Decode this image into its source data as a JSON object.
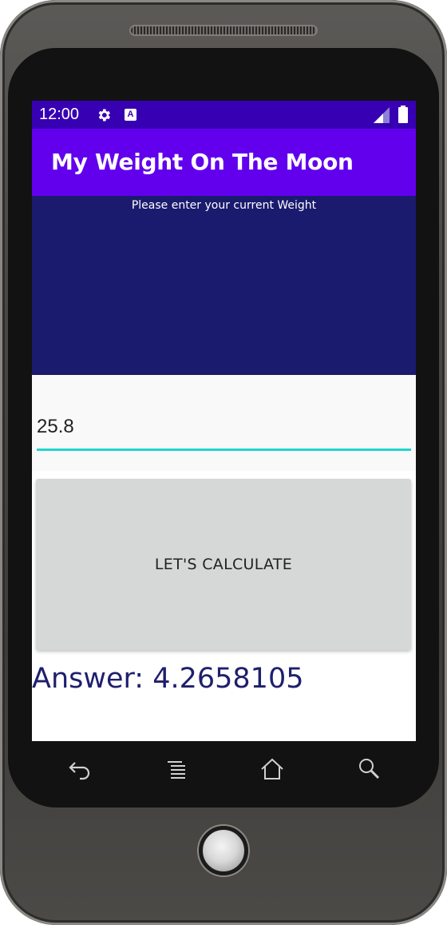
{
  "status_bar": {
    "time": "12:00",
    "icons": [
      "gear-icon",
      "a-icon",
      "signal-icon",
      "battery-icon"
    ],
    "color": "#3700b3"
  },
  "app_bar": {
    "title": "My Weight On The Moon",
    "color": "#6200ee"
  },
  "prompt": {
    "text": "Please enter your current Weight",
    "panel_color": "#1a1a6e"
  },
  "weight_input": {
    "value": "25.8",
    "underline_color": "#1fd6d0"
  },
  "calculate_button": {
    "label": "LET'S CALCULATE"
  },
  "result": {
    "text": "Answer: 4.2658105"
  },
  "nav_bar": {
    "icons": [
      "back-icon",
      "menu-icon",
      "home-icon",
      "search-icon"
    ]
  }
}
